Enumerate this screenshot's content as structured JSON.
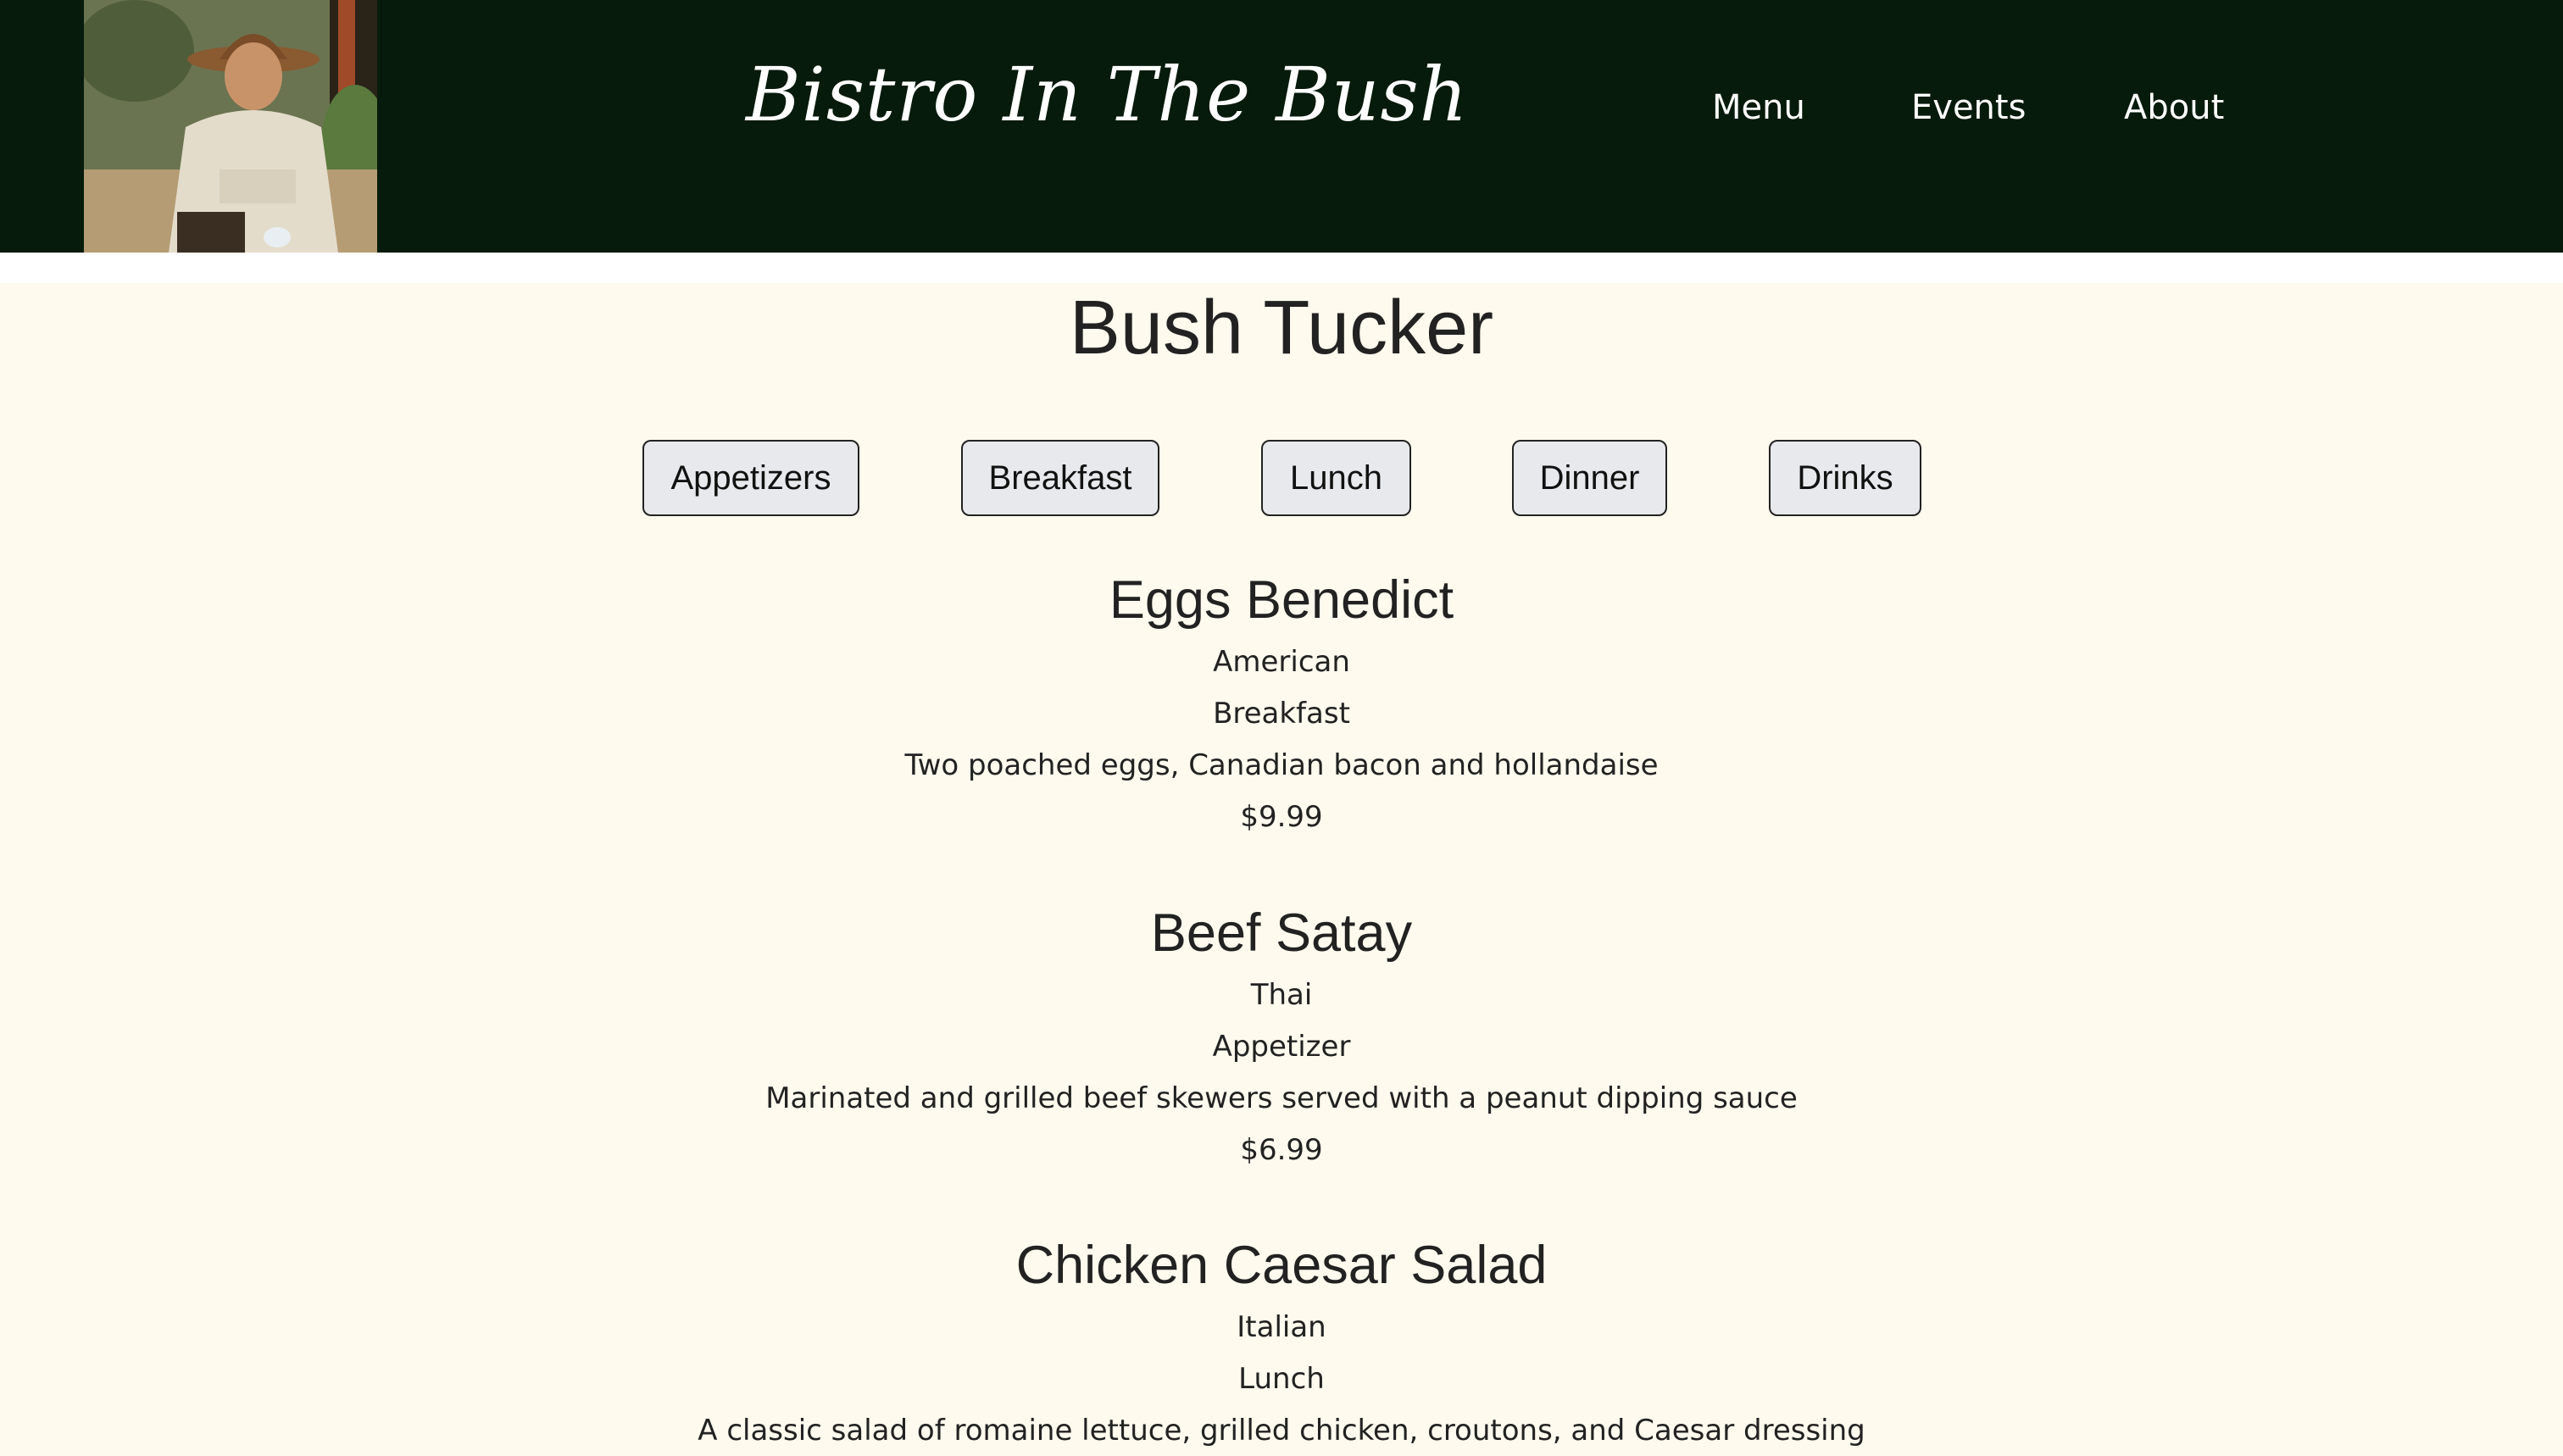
{
  "header": {
    "brand_title": "Bistro In The Bush",
    "bg_color": "#071b0c",
    "nav": [
      {
        "label": "Menu"
      },
      {
        "label": "Events"
      },
      {
        "label": "About"
      }
    ]
  },
  "main": {
    "page_title": "Bush Tucker",
    "background_color": "#fffaee",
    "filters": [
      {
        "label": "Appetizers"
      },
      {
        "label": "Breakfast"
      },
      {
        "label": "Lunch"
      },
      {
        "label": "Dinner"
      },
      {
        "label": "Drinks"
      }
    ],
    "items": [
      {
        "name": "Eggs Benedict",
        "cuisine": "American",
        "category": "Breakfast",
        "description": "Two poached eggs, Canadian bacon and hollandaise",
        "price": "$9.99"
      },
      {
        "name": "Beef Satay",
        "cuisine": "Thai",
        "category": "Appetizer",
        "description": "Marinated and grilled beef skewers served with a peanut dipping sauce",
        "price": "$6.99"
      },
      {
        "name": "Chicken Caesar Salad",
        "cuisine": "Italian",
        "category": "Lunch",
        "description": "A classic salad of romaine lettuce, grilled chicken, croutons, and Caesar dressing",
        "price": ""
      }
    ]
  }
}
